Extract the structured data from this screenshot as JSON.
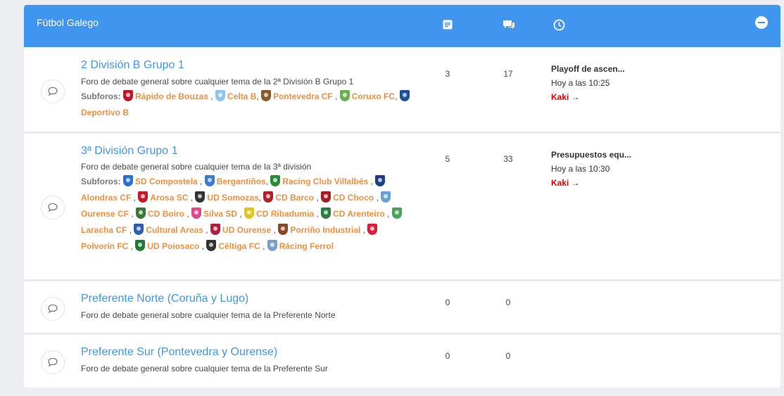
{
  "category": {
    "title": "Fútbol Galego",
    "icons": [
      "topics-icon",
      "posts-icon",
      "clock-icon",
      "collapse-icon"
    ]
  },
  "forums": [
    {
      "name": "2 División B Grupo 1",
      "description": "Foro de debate general sobre cualquier tema de la 2ª División B Grupo 1",
      "subforums_label": "Subforos:",
      "subforums": [
        {
          "name": "Rápido de Bouzas",
          "color": "#c0182a"
        },
        {
          "name": "Celta B",
          "color": "#8ec5ea"
        },
        {
          "name": "Pontevedra CF",
          "color": "#8a5a2b"
        },
        {
          "name": "Coruxo FC",
          "color": "#6ab04c"
        },
        {
          "name": "Deportivo B",
          "color": "#1e4f9c"
        }
      ],
      "topics": "3",
      "posts": "17",
      "last_post": {
        "title": "Playoff de ascen...",
        "time": "Hoy a las 10:25",
        "user": "Kaki",
        "arrow": "→"
      }
    },
    {
      "name": "3ª División Grupo 1",
      "description": "Foro de debate general sobre cualquier tema de la 3ª división",
      "subforums_label": "Subforos:",
      "subforums": [
        {
          "name": "SD Compostela",
          "color": "#2c6fd1"
        },
        {
          "name": "Bergantiños",
          "color": "#3a7bd5"
        },
        {
          "name": "Racing Club Villalbés",
          "color": "#2e8b3a"
        },
        {
          "name": "Alondras CF",
          "color": "#1d3f8a"
        },
        {
          "name": "Arosa SC",
          "color": "#c21b2c"
        },
        {
          "name": "UD Somozas",
          "color": "#333333"
        },
        {
          "name": "CD Barco",
          "color": "#b3202a"
        },
        {
          "name": "CD Choco",
          "color": "#a31d22"
        },
        {
          "name": "Ourense CF",
          "color": "#6aa0d8"
        },
        {
          "name": "CD Boiro",
          "color": "#3b7a34"
        },
        {
          "name": "Silva SD",
          "color": "#d94b8a"
        },
        {
          "name": "CD Ribadumia",
          "color": "#e6c31a"
        },
        {
          "name": "CD Arenteiro",
          "color": "#2f7d3e"
        },
        {
          "name": "Laracha CF",
          "color": "#4aa25a"
        },
        {
          "name": "Cultural Areas",
          "color": "#2b5fb0"
        },
        {
          "name": "UD Ourense",
          "color": "#b0203a"
        },
        {
          "name": "Porriño Industrial",
          "color": "#8a4a2a"
        },
        {
          "name": "Polvorín FC",
          "color": "#d8203a"
        },
        {
          "name": "UD Poiosaco",
          "color": "#1f7a3a"
        },
        {
          "name": "Céltiga FC",
          "color": "#333333"
        },
        {
          "name": "Rácing Ferrol",
          "color": "#7aa0c8"
        }
      ],
      "topics": "5",
      "posts": "33",
      "last_post": {
        "title": "Presupuestos equ...",
        "time": "Hoy a las 10:30",
        "user": "Kaki",
        "arrow": "→"
      }
    },
    {
      "name": "Preferente Norte (Coruña y Lugo)",
      "description": "Foro de debate general sobre cualquier tema de la Preferente Norte",
      "topics": "0",
      "posts": "0"
    },
    {
      "name": "Preferente Sur (Pontevedra y Ourense)",
      "description": "Foro de debate general sobre cualquier tema de la Preferente Sur",
      "topics": "0",
      "posts": "0"
    }
  ],
  "colors": {
    "header": "#4096ee",
    "link": "#4096ee",
    "subforum": "#f08f3e",
    "user": "#e00000"
  }
}
